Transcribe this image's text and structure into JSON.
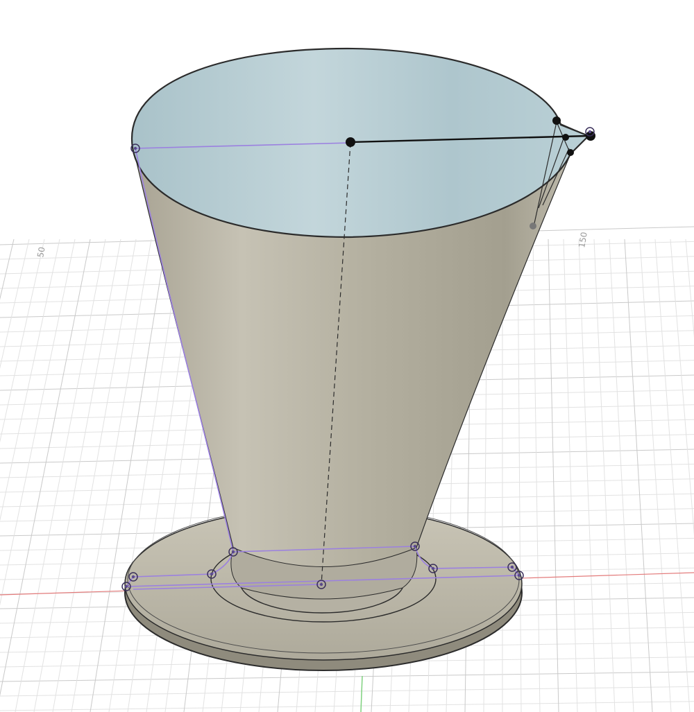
{
  "viewport": {
    "grid_labels": [
      "50",
      "150"
    ]
  },
  "colors": {
    "background": "#ffffff",
    "grid_line": "#dcdcdc",
    "grid_major": "#c4c4c4",
    "x_axis": "#e37b7b",
    "z_axis": "#7fd17f",
    "body_fill": "#b9b5a6",
    "body_inner": "#b9cfd5",
    "sketch_line": "#9b80e0",
    "edge": "#2b2b2b"
  },
  "icons": {
    "sketch_point": "circle-dot-icon",
    "endpoint": "filled-circle-icon"
  }
}
